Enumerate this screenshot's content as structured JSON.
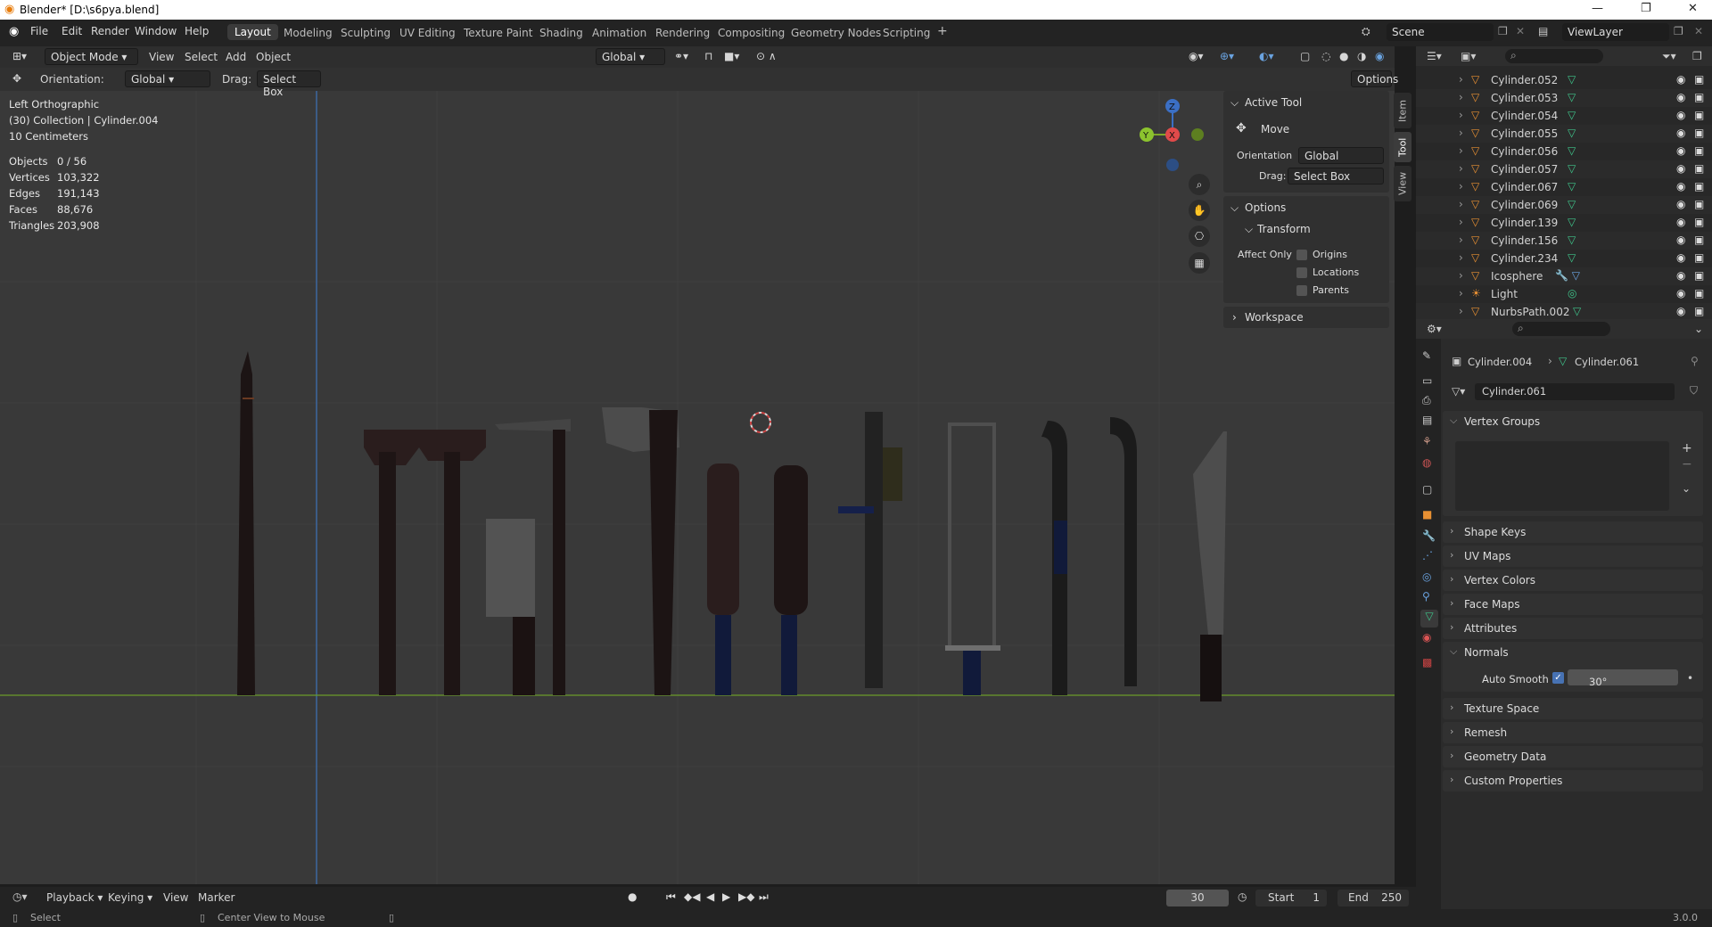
{
  "window": {
    "title": "Blender* [D:\\s6pya.blend]"
  },
  "menu": [
    "File",
    "Edit",
    "Render",
    "Window",
    "Help"
  ],
  "workspaces": [
    "Layout",
    "Modeling",
    "Sculpting",
    "UV Editing",
    "Texture Paint",
    "Shading",
    "Animation",
    "Rendering",
    "Compositing",
    "Geometry Nodes",
    "Scripting"
  ],
  "active_workspace": "Layout",
  "scene": {
    "name": "Scene",
    "view_layer": "ViewLayer"
  },
  "viewport_header": {
    "mode": "Object Mode",
    "view": "View",
    "select": "Select",
    "add": "Add",
    "object": "Object",
    "transform": "Global"
  },
  "tool_header": {
    "orientation_label": "Orientation:",
    "orientation": "Global",
    "drag_label": "Drag:",
    "drag": "Select Box",
    "options": "Options"
  },
  "overlay": {
    "view_name": "Left Orthographic",
    "collection": "(30) Collection | Cylinder.004",
    "scale": "10 Centimeters",
    "stats": [
      {
        "label": "Objects",
        "value": "0 / 56"
      },
      {
        "label": "Vertices",
        "value": "103,322"
      },
      {
        "label": "Edges",
        "value": "191,143"
      },
      {
        "label": "Faces",
        "value": "88,676"
      },
      {
        "label": "Triangles",
        "value": "203,908"
      }
    ]
  },
  "gizmo": {
    "z": "Z",
    "y": "Y",
    "x": "X"
  },
  "npanel": {
    "active_tool": "Active Tool",
    "move": "Move",
    "orientation_label": "Orientation",
    "orientation": "Global",
    "drag_label": "Drag:",
    "drag": "Select Box",
    "options": "Options",
    "transform": "Transform",
    "affect_only": "Affect Only",
    "origins": "Origins",
    "locations": "Locations",
    "parents": "Parents",
    "workspace": "Workspace",
    "tabs": [
      "Item",
      "Tool",
      "View"
    ]
  },
  "outliner": {
    "rows": [
      {
        "name": "Cylinder.052",
        "type": "mesh"
      },
      {
        "name": "Cylinder.053",
        "type": "mesh"
      },
      {
        "name": "Cylinder.054",
        "type": "mesh"
      },
      {
        "name": "Cylinder.055",
        "type": "mesh"
      },
      {
        "name": "Cylinder.056",
        "type": "mesh"
      },
      {
        "name": "Cylinder.057",
        "type": "mesh"
      },
      {
        "name": "Cylinder.067",
        "type": "mesh"
      },
      {
        "name": "Cylinder.069",
        "type": "mesh"
      },
      {
        "name": "Cylinder.139",
        "type": "mesh"
      },
      {
        "name": "Cylinder.156",
        "type": "mesh"
      },
      {
        "name": "Cylinder.234",
        "type": "mesh"
      },
      {
        "name": "Icosphere",
        "type": "mesh-mod"
      },
      {
        "name": "Light",
        "type": "light"
      },
      {
        "name": "NurbsPath.002",
        "type": "mesh"
      }
    ]
  },
  "properties": {
    "breadcrumb_object": "Cylinder.004",
    "breadcrumb_data": "Cylinder.061",
    "datablock": "Cylinder.061",
    "sections": [
      "Vertex Groups",
      "Shape Keys",
      "UV Maps",
      "Vertex Colors",
      "Face Maps",
      "Attributes",
      "Normals",
      "Texture Space",
      "Remesh",
      "Geometry Data",
      "Custom Properties"
    ],
    "auto_smooth_label": "Auto Smooth",
    "auto_smooth_angle": "30°"
  },
  "timeline": {
    "playback": "Playback",
    "keying": "Keying",
    "view": "View",
    "marker": "Marker",
    "current_frame": "30",
    "start_label": "Start",
    "start": "1",
    "end_label": "End",
    "end": "250"
  },
  "statusbar": {
    "left": "Select",
    "middle": "Center View to Mouse",
    "version": "3.0.0"
  }
}
